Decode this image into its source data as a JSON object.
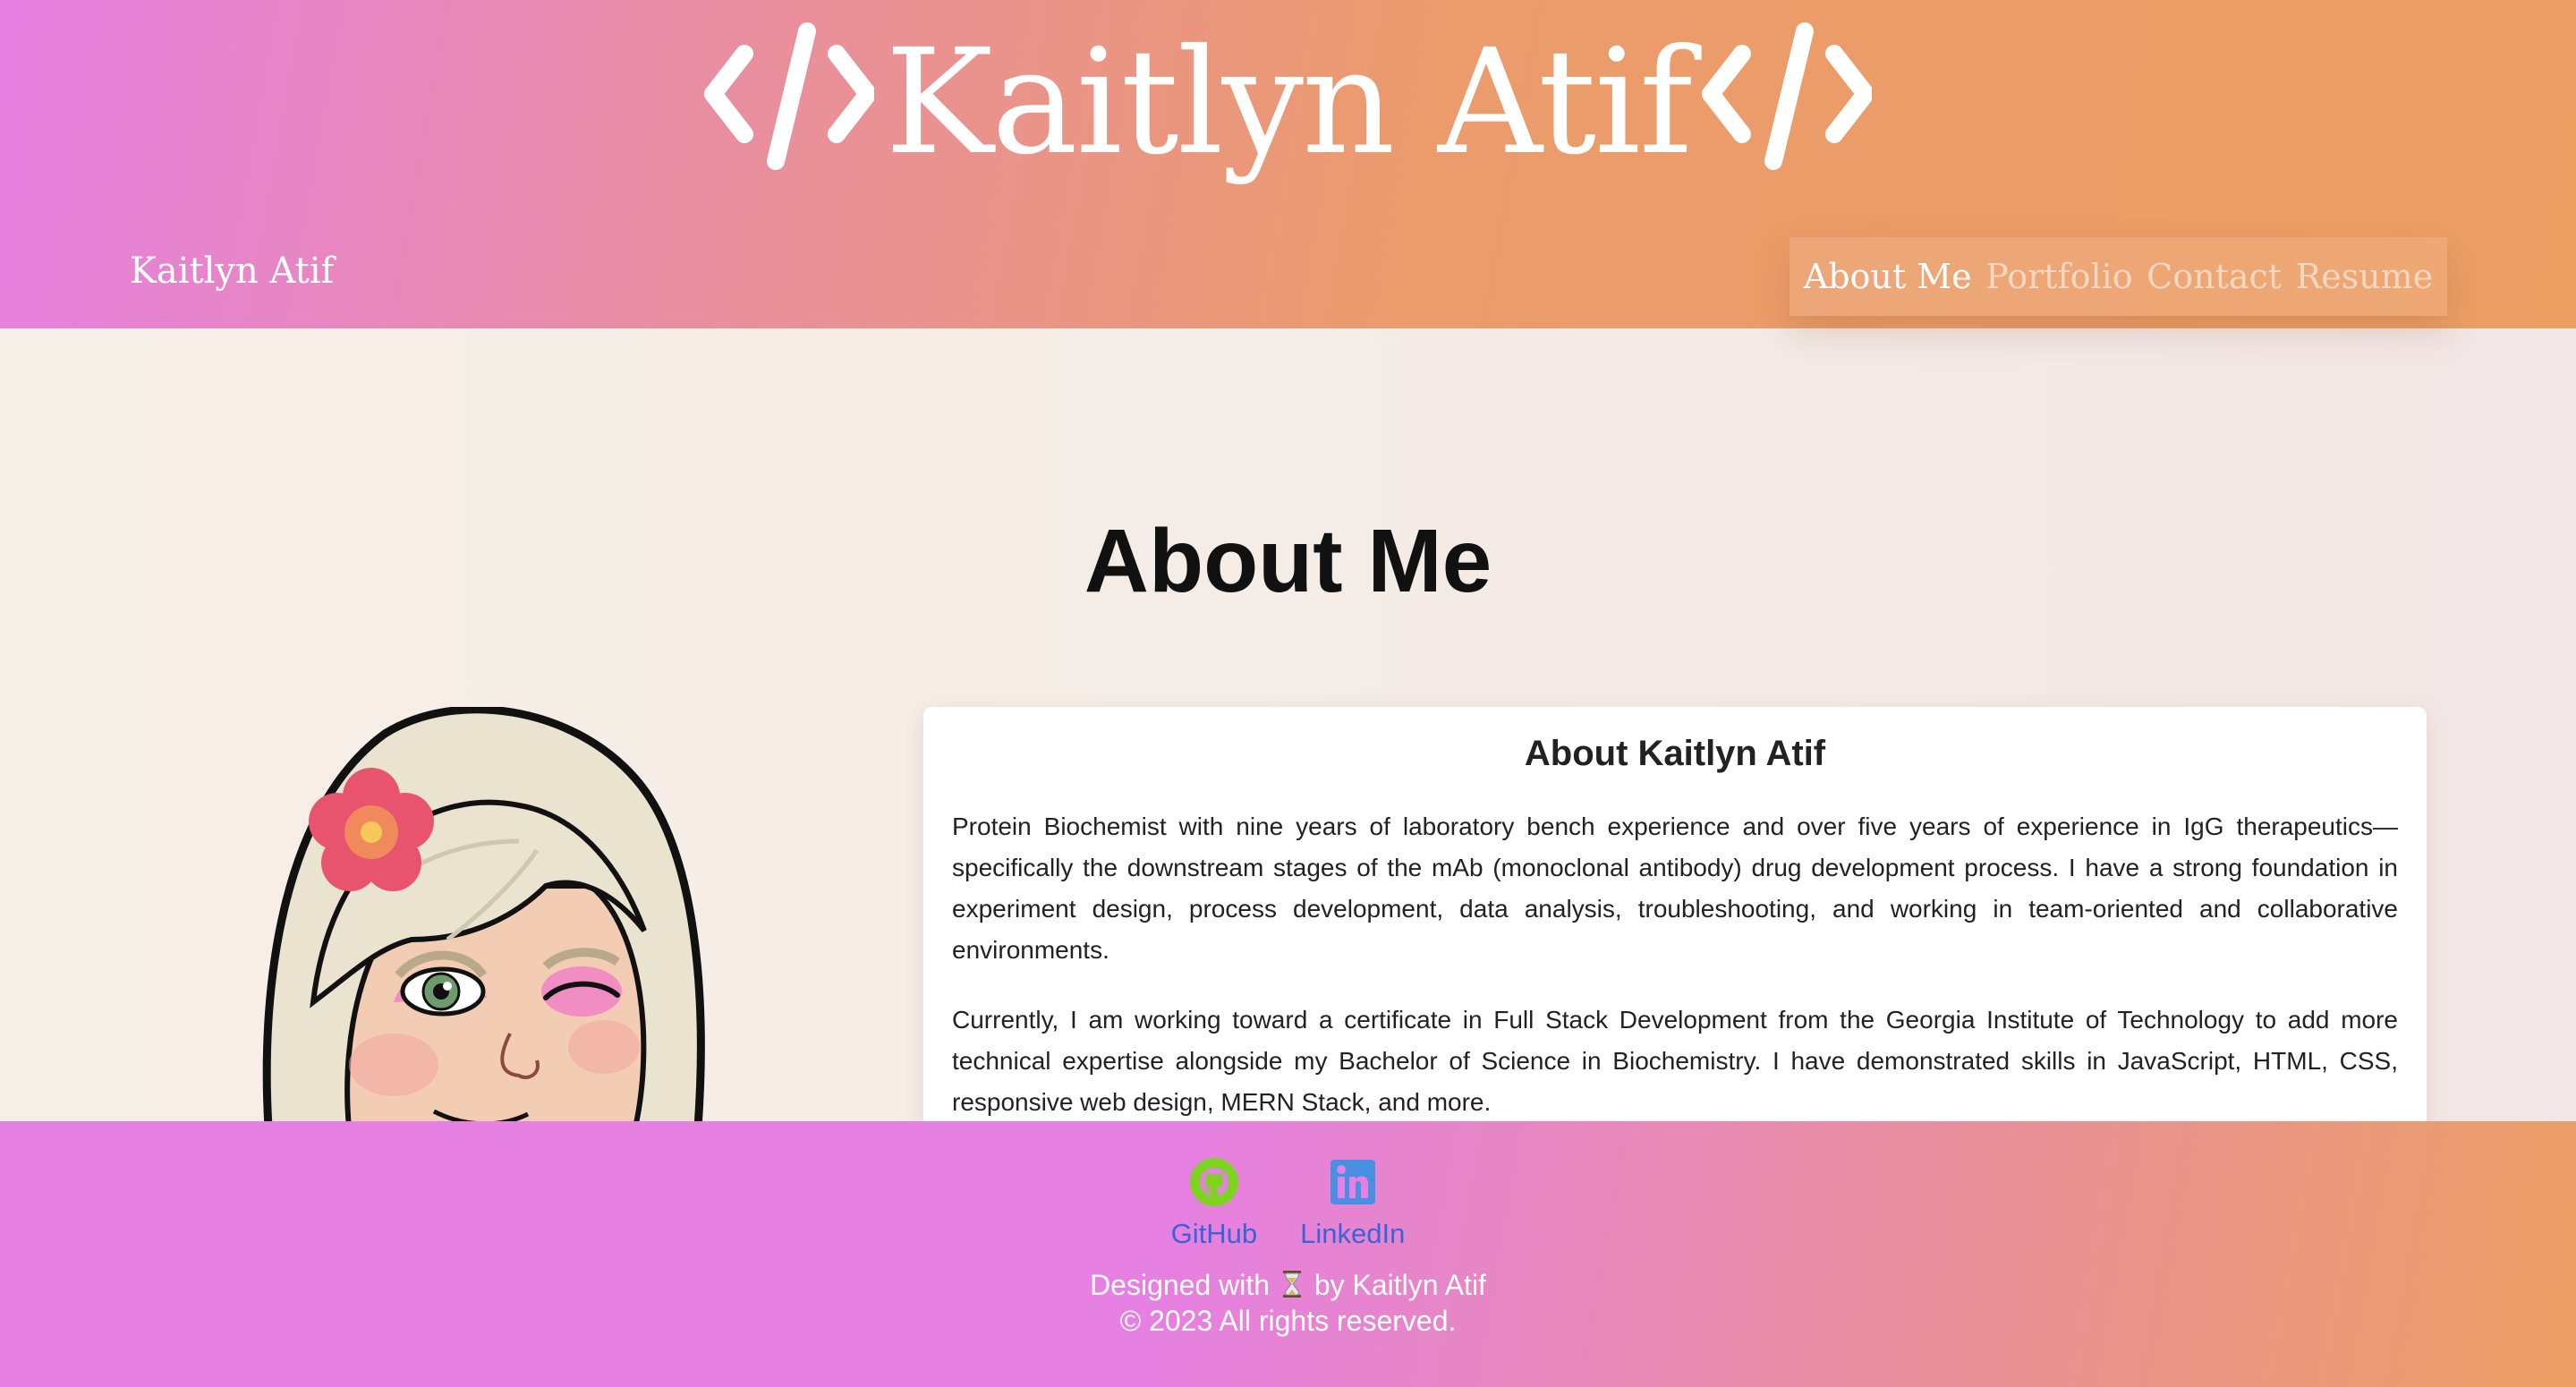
{
  "header": {
    "title": "Kaitlyn Atif",
    "brand_icon": "code-icon",
    "nav_name": "Kaitlyn Atif",
    "nav": [
      {
        "label": "About Me",
        "active": true
      },
      {
        "label": "Portfolio",
        "active": false
      },
      {
        "label": "Contact",
        "active": false
      },
      {
        "label": "Resume",
        "active": false
      }
    ]
  },
  "main": {
    "heading": "About Me",
    "avatar_icon": "avatar-icon",
    "card": {
      "title": "About Kaitlyn Atif",
      "paragraphs": [
        "Protein Biochemist with nine years of laboratory bench experience and over five years of experience in IgG therapeutics—specifically the downstream stages of the mAb (monoclonal antibody) drug development process. I have a strong foundation in experiment design, process development, data analysis, troubleshooting, and working in team-oriented and collaborative environments.",
        "Currently, I am working toward a certificate in Full Stack Development from the Georgia Institute of Technology to add more technical expertise alongside my Bachelor of Science in Biochemistry. I have demonstrated skills in JavaScript, HTML, CSS, responsive web design, MERN Stack, and more."
      ]
    }
  },
  "footer": {
    "social": [
      {
        "label": "GitHub",
        "icon": "github-icon",
        "color": "#7ed321"
      },
      {
        "label": "LinkedIn",
        "icon": "linkedin-icon",
        "color": "#4a90e2"
      }
    ],
    "designed_prefix": "Designed with",
    "designed_suffix": "by Kaitlyn Atif",
    "copyright": "© 2023 All rights reserved.",
    "hourglass_icon": "hourglass-icon"
  },
  "colors": {
    "header_gradient_start": "#e680e2",
    "header_gradient_end": "#eb9f63",
    "footer_link": "#3a63d9"
  }
}
